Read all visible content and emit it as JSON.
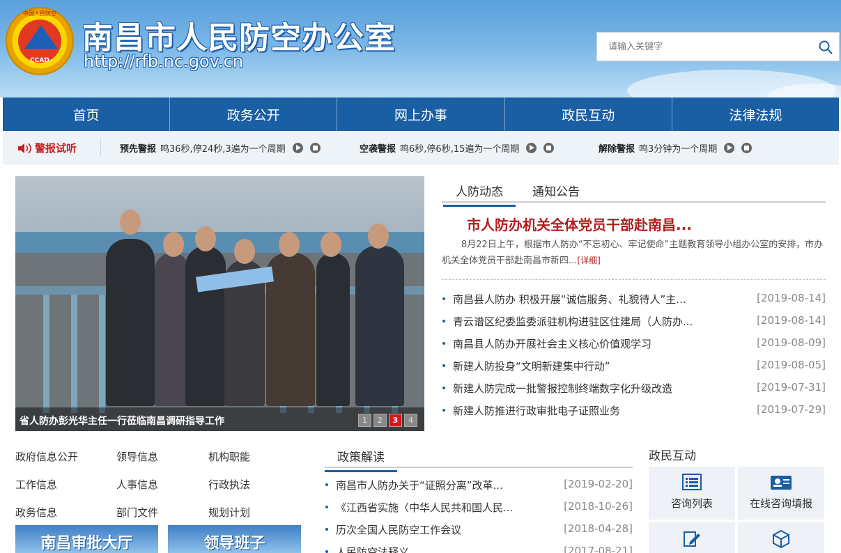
{
  "header": {
    "site_title": "南昌市人民防空办公室",
    "site_url": "http://rfb.nc.gov.cn",
    "emblem_text": "CCAD",
    "emblem_ring": "中国人民防空",
    "search_placeholder": "请输入关键字"
  },
  "nav": [
    "首页",
    "政务公开",
    "网上办事",
    "政民互动",
    "法律法规"
  ],
  "alarm": {
    "title": "警报试听",
    "items": [
      {
        "name": "预先警报",
        "desc": "鸣36秒,停24秒,3遍为一个周期"
      },
      {
        "name": "空袭警报",
        "desc": "鸣6秒,停6秒,15遍为一个周期"
      },
      {
        "name": "解除警报",
        "desc": "鸣3分钟为一个周期"
      }
    ]
  },
  "slider": {
    "caption": "省人防办彭光华主任一行莅临南昌调研指导工作",
    "dots": [
      "1",
      "2",
      "3",
      "4"
    ],
    "active_dot": 3
  },
  "news": {
    "tabs": [
      "人防动态",
      "通知公告"
    ],
    "headline": "市人防办机关全体党员干部赴南昌...",
    "summary": "8月22日上午，根据市人防办“不忘初心、牢记使命”主题教育领导小组办公室的安排，市办机关全体党员干部赴南昌市新四...",
    "more": "[详细]",
    "items": [
      {
        "title": "南昌县人防办 积极开展“诚信服务、礼貌待人”主...",
        "date": "[2019-08-14]"
      },
      {
        "title": "青云谱区纪委监委派驻机构进驻区住建局（人防办...",
        "date": "[2019-08-14]"
      },
      {
        "title": "南昌县人防办开展社会主义核心价值观学习",
        "date": "[2019-08-09]"
      },
      {
        "title": "新建人防投身“文明新建集中行动”",
        "date": "[2019-08-05]"
      },
      {
        "title": "新建人防完成一批警报控制终端数字化升级改造",
        "date": "[2019-07-31]"
      },
      {
        "title": "新建人防推进行政审批电子证照业务",
        "date": "[2019-07-29]"
      }
    ]
  },
  "quick_links": [
    "政府信息公开",
    "领导信息",
    "机构职能",
    "工作信息",
    "人事信息",
    "行政执法",
    "政务信息",
    "部门文件",
    "规划计划"
  ],
  "banners": [
    "南昌审批大厅",
    "领导班子"
  ],
  "policy": {
    "title": "政策解读",
    "items": [
      {
        "title": "南昌市人防办关于“证照分离”改革...",
        "date": "[2019-02-20]"
      },
      {
        "title": "《江西省实施〈中华人民共和国人民...",
        "date": "[2018-10-26]"
      },
      {
        "title": "历次全国人民防空工作会议",
        "date": "[2018-04-28]"
      },
      {
        "title": "人民防空法释义",
        "date": "[2017-08-21]"
      }
    ]
  },
  "interaction": {
    "title": "政民互动",
    "cells": [
      {
        "label": "咨询列表",
        "icon": "list-icon"
      },
      {
        "label": "在线咨询填报",
        "icon": "id-card-icon"
      },
      {
        "label": "",
        "icon": "edit-icon"
      },
      {
        "label": "",
        "icon": "cube-icon"
      }
    ]
  },
  "colors": {
    "nav_bg": "#1a5ea4",
    "headline_red": "#b21d1d",
    "alarm_red": "#c71f1f"
  }
}
